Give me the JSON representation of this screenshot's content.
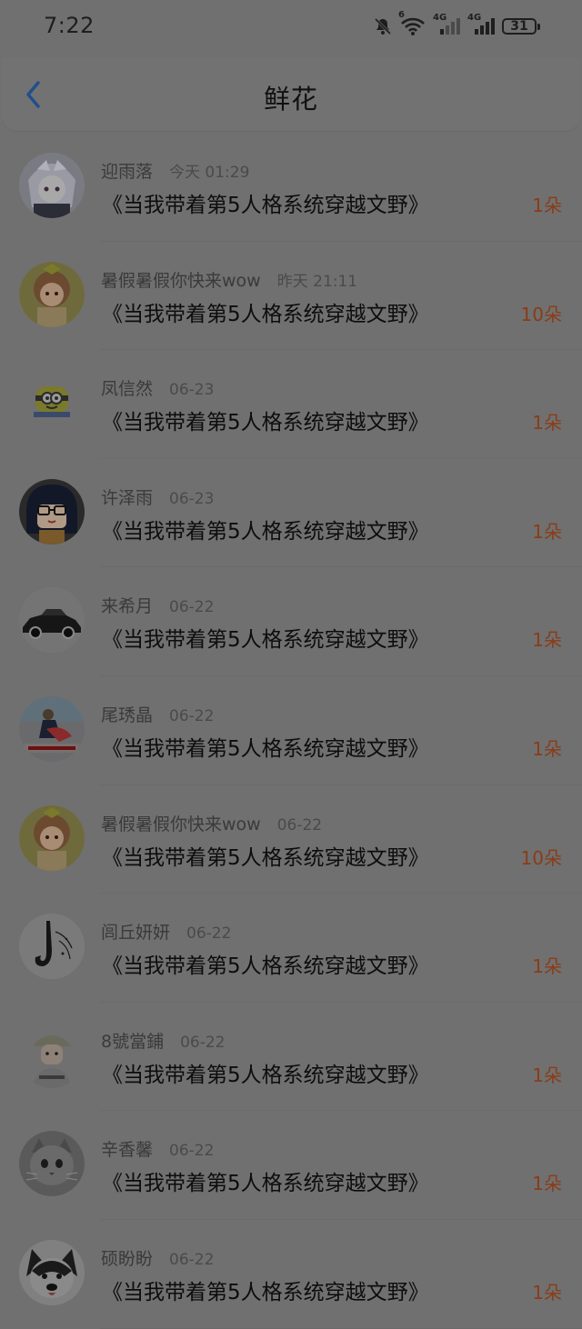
{
  "status": {
    "time": "7:22",
    "battery": "31",
    "network_labels": [
      "4G",
      "4G"
    ],
    "wifi_badge": "6"
  },
  "header": {
    "title": "鲜花"
  },
  "colors": {
    "accent_back": "#1f4f8c",
    "amount": "#8a3c16",
    "overlay_bg": "#707070"
  },
  "rows": [
    {
      "name": "迎雨落",
      "time": "今天 01:29",
      "book": "《当我带着第5人格系统穿越文野》",
      "amount": "1朵",
      "avatar": "anime-girl-avatar"
    },
    {
      "name": "暑假暑假你快来wow",
      "time": "昨天 21:11",
      "book": "《当我带着第5人格系统穿越文野》",
      "amount": "10朵",
      "avatar": "cartoon-girl-avatar"
    },
    {
      "name": "凤信然",
      "time": "06-23",
      "book": "《当我带着第5人格系统穿越文野》",
      "amount": "1朵",
      "avatar": "minion-avatar"
    },
    {
      "name": "许泽雨",
      "time": "06-23",
      "book": "《当我带着第5人格系统穿越文野》",
      "amount": "1朵",
      "avatar": "glasses-girl-avatar"
    },
    {
      "name": "来希月",
      "time": "06-22",
      "book": "《当我带着第5人格系统穿越文野》",
      "amount": "1朵",
      "avatar": "car-avatar"
    },
    {
      "name": "尾琇晶",
      "time": "06-22",
      "book": "《当我带着第5人格系统穿越文野》",
      "amount": "1朵",
      "avatar": "couple-avatar"
    },
    {
      "name": "暑假暑假你快来wow",
      "time": "06-22",
      "book": "《当我带着第5人格系统穿越文野》",
      "amount": "10朵",
      "avatar": "cartoon-girl-avatar"
    },
    {
      "name": "闾丘妍妍",
      "time": "06-22",
      "book": "《当我带着第5人格系统穿越文野》",
      "amount": "1朵",
      "avatar": "saxophone-avatar"
    },
    {
      "name": "8號當鋪",
      "time": "06-22",
      "book": "《当我带着第5人格系统穿越文野》",
      "amount": "1朵",
      "avatar": "cap-boy-avatar"
    },
    {
      "name": "辛香馨",
      "time": "06-22",
      "book": "《当我带着第5人格系统穿越文野》",
      "amount": "1朵",
      "avatar": "cat-avatar"
    },
    {
      "name": "硕盼盼",
      "time": "06-22",
      "book": "《当我带着第5人格系统穿越文野》",
      "amount": "1朵",
      "avatar": "dog-avatar"
    }
  ]
}
